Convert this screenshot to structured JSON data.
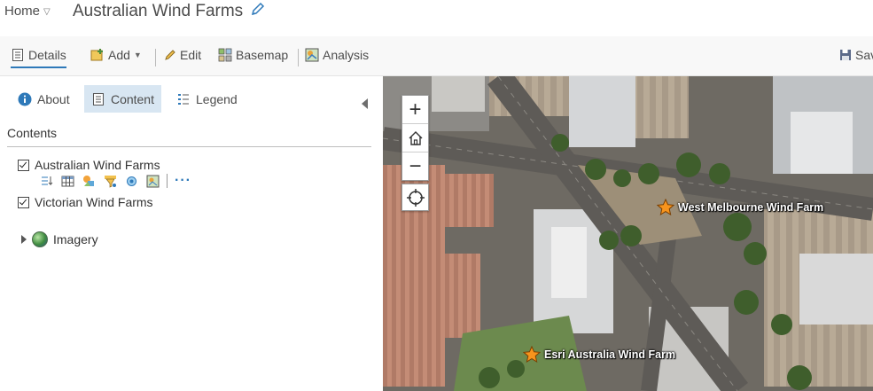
{
  "header": {
    "home_label": "Home",
    "map_title": "Australian Wind Farms"
  },
  "toolbar": {
    "details": "Details",
    "add": "Add",
    "edit": "Edit",
    "basemap": "Basemap",
    "analysis": "Analysis",
    "save": "Sav"
  },
  "panel": {
    "tabs": {
      "about": "About",
      "content": "Content",
      "legend": "Legend"
    },
    "contents_heading": "Contents",
    "layers": [
      {
        "label": "Australian Wind Farms",
        "checked": true
      },
      {
        "label": "Victorian Wind Farms",
        "checked": true
      }
    ],
    "group_layer": "Imagery",
    "more": "···"
  },
  "map": {
    "zoom_in": "+",
    "zoom_out": "−",
    "farms": [
      {
        "label": "West Melbourne Wind Farm"
      },
      {
        "label": "Esri Australia Wind Farm"
      }
    ]
  },
  "colors": {
    "accent": "#2e79b9",
    "active_tab_bg": "#d8e6f2",
    "star": "#f7941d"
  }
}
